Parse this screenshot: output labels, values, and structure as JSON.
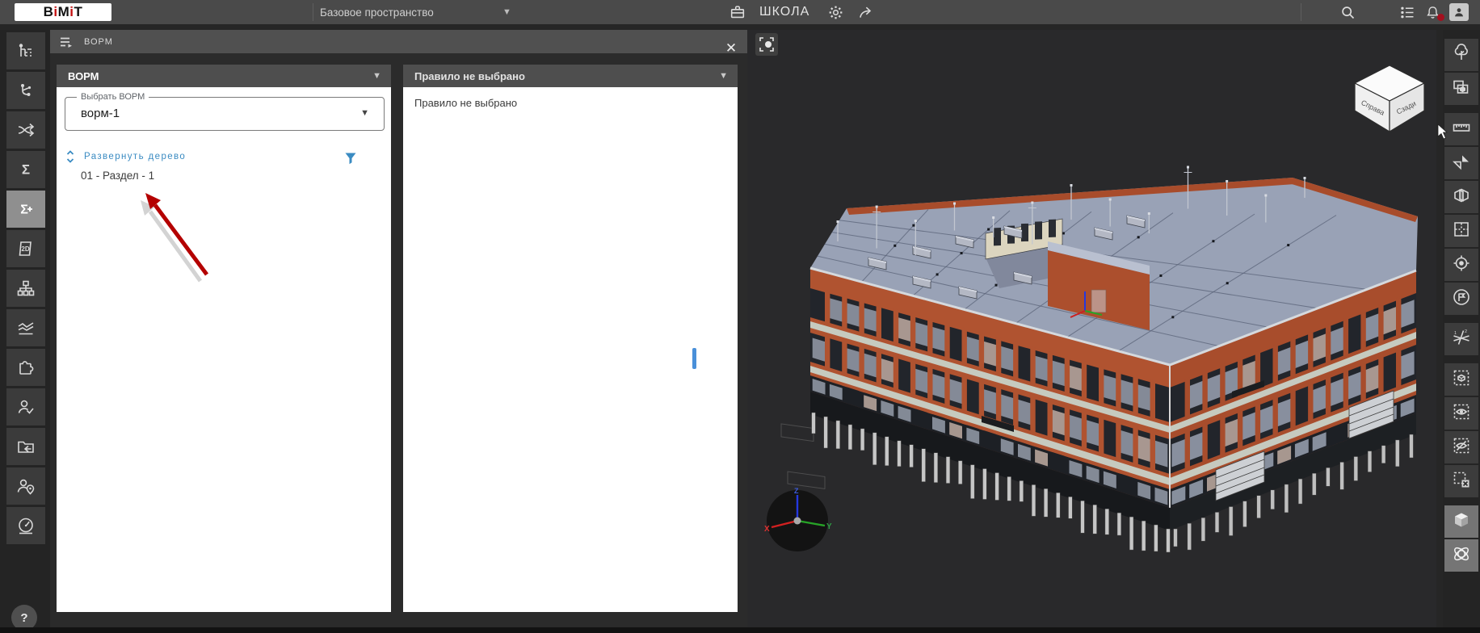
{
  "topbar": {
    "logo_text": "BiMiT",
    "workspace_selector": "Базовое пространство",
    "project_title": "ШКОЛА"
  },
  "dock": {
    "title": "ВОРМ",
    "vorm_section": {
      "header": "ВОРМ",
      "select_label": "Выбрать ВОРМ",
      "select_value": "ворм-1",
      "expand_tree_link": "Развернуть дерево",
      "tree_items": [
        "01 - Раздел - 1"
      ]
    },
    "rule_section": {
      "header": "Правило не выбрано",
      "empty_text": "Правило не выбрано"
    }
  },
  "left_toolbar": {
    "help_button": "?",
    "items": [
      {
        "name": "model-tree",
        "icon": "tree-structure-icon",
        "active": false
      },
      {
        "name": "relations",
        "icon": "branch-icon",
        "active": false
      },
      {
        "name": "shuffle",
        "icon": "shuffle-icon",
        "active": false
      },
      {
        "name": "summary",
        "icon": "sigma-icon",
        "active": false
      },
      {
        "name": "summary-add",
        "icon": "sigma-plus-icon",
        "active": true
      },
      {
        "name": "drawings-2d",
        "icon": "doc-2d-icon",
        "active": false
      },
      {
        "name": "structure",
        "icon": "sitemap-icon",
        "active": false
      },
      {
        "name": "analytics",
        "icon": "trend-lines-icon",
        "active": false
      },
      {
        "name": "plugins",
        "icon": "puzzle-icon",
        "active": false
      },
      {
        "name": "user-approve",
        "icon": "user-check-icon",
        "active": false
      },
      {
        "name": "folder-export",
        "icon": "folder-arrow-icon",
        "active": false
      },
      {
        "name": "user-location",
        "icon": "user-pin-icon",
        "active": false
      },
      {
        "name": "dashboard",
        "icon": "gauge-icon",
        "active": false
      }
    ]
  },
  "right_toolbar": {
    "groups": [
      [
        {
          "name": "environment",
          "icon": "nature-tree-icon",
          "active": false
        },
        {
          "name": "select-similar",
          "icon": "capture-icon",
          "active": false
        }
      ],
      [
        {
          "name": "measure",
          "icon": "ruler-icon",
          "active": false
        },
        {
          "name": "section-flip",
          "icon": "flash-icon",
          "active": false
        },
        {
          "name": "section-box",
          "icon": "cube-section-icon",
          "active": false
        },
        {
          "name": "floor-plan",
          "icon": "floorplan-icon",
          "active": false
        },
        {
          "name": "locate",
          "icon": "target-icon",
          "active": false
        },
        {
          "name": "flag",
          "icon": "flag-icon",
          "active": false
        }
      ],
      [
        {
          "name": "axes-lines",
          "icon": "cross-lines-icon",
          "active": false
        }
      ],
      [
        {
          "name": "isolate",
          "icon": "dashed-cube-icon",
          "active": false
        },
        {
          "name": "show",
          "icon": "eye-icon",
          "active": false
        },
        {
          "name": "hide",
          "icon": "eye-off-icon",
          "active": false
        },
        {
          "name": "clear-selection",
          "icon": "dashed-x-icon",
          "active": false
        }
      ],
      [
        {
          "name": "shaded-view",
          "icon": "solid-cube-icon",
          "active": true
        },
        {
          "name": "orbit-mode",
          "icon": "orbit-icon",
          "active": true
        }
      ]
    ]
  },
  "viewport": {
    "nav_cube": {
      "left_face_label": "Справа",
      "right_face_label": "Сзади"
    },
    "axis_gizmo": {
      "x_label": "X",
      "y_label": "Y",
      "z_label": "Z"
    }
  },
  "colors": {
    "accent_blue": "#3a8bc2",
    "annotation_arrow": "#b40000",
    "notification_badge": "#a40f1e",
    "facade_orange": "#b05330",
    "facade_orange_right": "#a84d2c",
    "roof_gray": "#99a2b6",
    "window_band": "#22252b",
    "trim_band": "#c6cabf",
    "plinth": "#17191c",
    "piles": "#c6c6c6",
    "courtyard_wall": "#dcd5bf"
  }
}
